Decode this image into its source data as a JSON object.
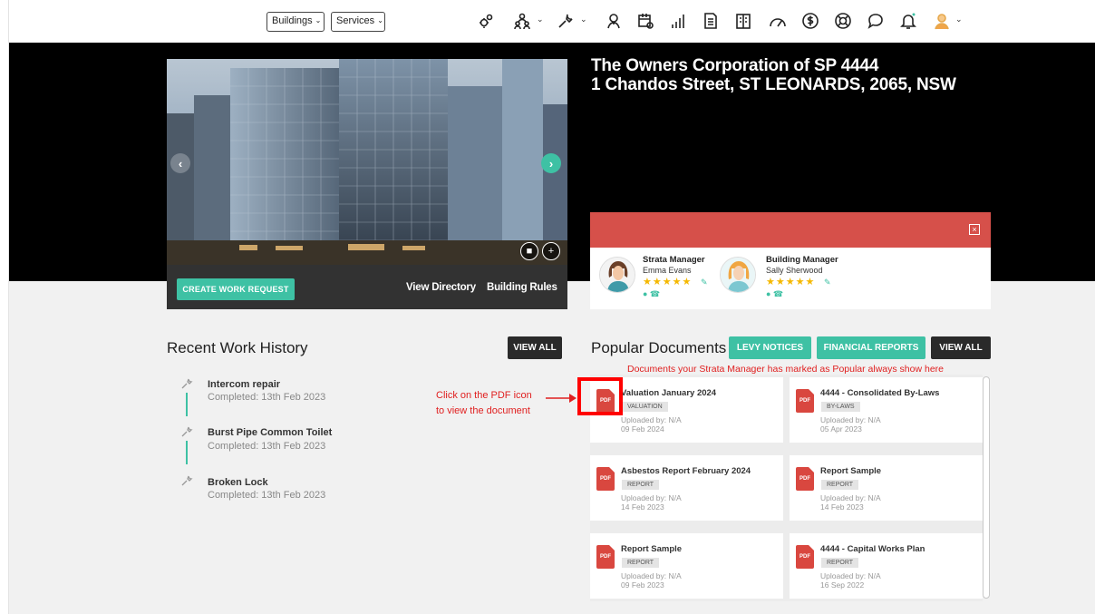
{
  "nav": {
    "buildings_label": "Buildings",
    "services_label": "Services",
    "icons": [
      "gears-icon",
      "people-icon",
      "wrench-icon",
      "person-pin-icon",
      "calendar-icon",
      "bar-chart-icon",
      "document-icon",
      "building-icon",
      "gauge-icon",
      "dollar-icon",
      "lifebuoy-icon",
      "chat-icon",
      "bell-icon",
      "avatar-icon"
    ]
  },
  "hero": {
    "title_line1": "The Owners Corporation of SP 4444",
    "title_line2": "1 Chandos Street, ST LEONARDS, 2065, NSW",
    "create_work_request": "CREATE WORK REQUEST",
    "view_directory": "View Directory",
    "building_rules": "Building Rules"
  },
  "managers": {
    "strata": {
      "role": "Strata Manager",
      "name": "Emma Evans",
      "rating": 5
    },
    "building": {
      "role": "Building Manager",
      "name": "Sally Sherwood",
      "rating": 5
    }
  },
  "recent_work": {
    "title": "Recent Work History",
    "view_all": "VIEW ALL",
    "items": [
      {
        "title": "Intercom repair",
        "status": "Completed: 13th Feb 2023"
      },
      {
        "title": "Burst Pipe Common Toilet",
        "status": "Completed: 13th Feb 2023"
      },
      {
        "title": "Broken Lock",
        "status": "Completed: 13th Feb 2023"
      }
    ]
  },
  "annotations": {
    "pdf_hint_line1": "Click on the PDF icon",
    "pdf_hint_line2": "to view the document",
    "popular_hint": "Documents your Strata Manager has marked as Popular always show here"
  },
  "documents": {
    "title": "Popular Documents",
    "levy_notices": "LEVY NOTICES",
    "financial_reports": "FINANCIAL REPORTS",
    "view_all": "VIEW ALL",
    "pdf_label": "PDF",
    "items": [
      {
        "title": "Valuation January 2024",
        "tag": "VALUATION",
        "uploaded": "Uploaded by: N/A",
        "date": "09 Feb 2024"
      },
      {
        "title": "4444 - Consolidated By-Laws",
        "tag": "BY-LAWS",
        "uploaded": "Uploaded by: N/A",
        "date": "05 Apr 2023"
      },
      {
        "title": "Asbestos Report February 2024",
        "tag": "REPORT",
        "uploaded": "Uploaded by: N/A",
        "date": "14 Feb 2023"
      },
      {
        "title": "Report Sample",
        "tag": "REPORT",
        "uploaded": "Uploaded by: N/A",
        "date": "14 Feb 2023"
      },
      {
        "title": "Report Sample",
        "tag": "REPORT",
        "uploaded": "Uploaded by: N/A",
        "date": "09 Feb 2023"
      },
      {
        "title": "4444 - Capital Works Plan",
        "tag": "REPORT",
        "uploaded": "Uploaded by: N/A",
        "date": "16 Sep 2022"
      }
    ]
  },
  "colors": {
    "accent": "#3ec1a4",
    "card_header": "#d6504a",
    "annotation": "#e02020",
    "star": "#f5b800"
  }
}
